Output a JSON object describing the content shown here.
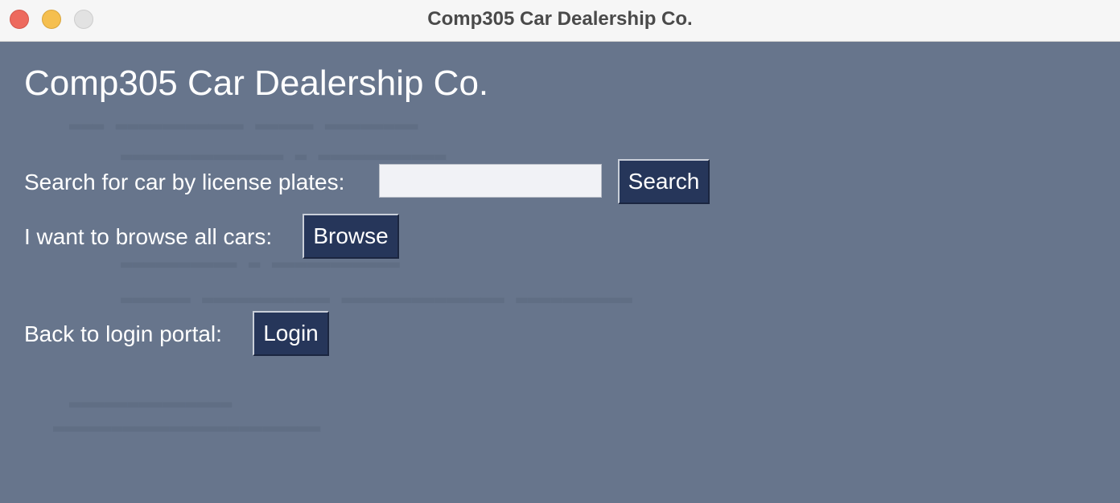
{
  "window": {
    "title": "Comp305 Car Dealership Co."
  },
  "main": {
    "heading": "Comp305 Car Dealership Co.",
    "search": {
      "label": "Search for car by license plates:",
      "value": "",
      "placeholder": "",
      "button_label": "Search"
    },
    "browse": {
      "label": "I want to browse all cars:",
      "button_label": "Browse"
    },
    "login": {
      "label": "Back to login portal:",
      "button_label": "Login"
    }
  },
  "colors": {
    "background": "#67758c",
    "button": "#26365a",
    "input": "#f1f2f6",
    "text": "#ffffff"
  }
}
